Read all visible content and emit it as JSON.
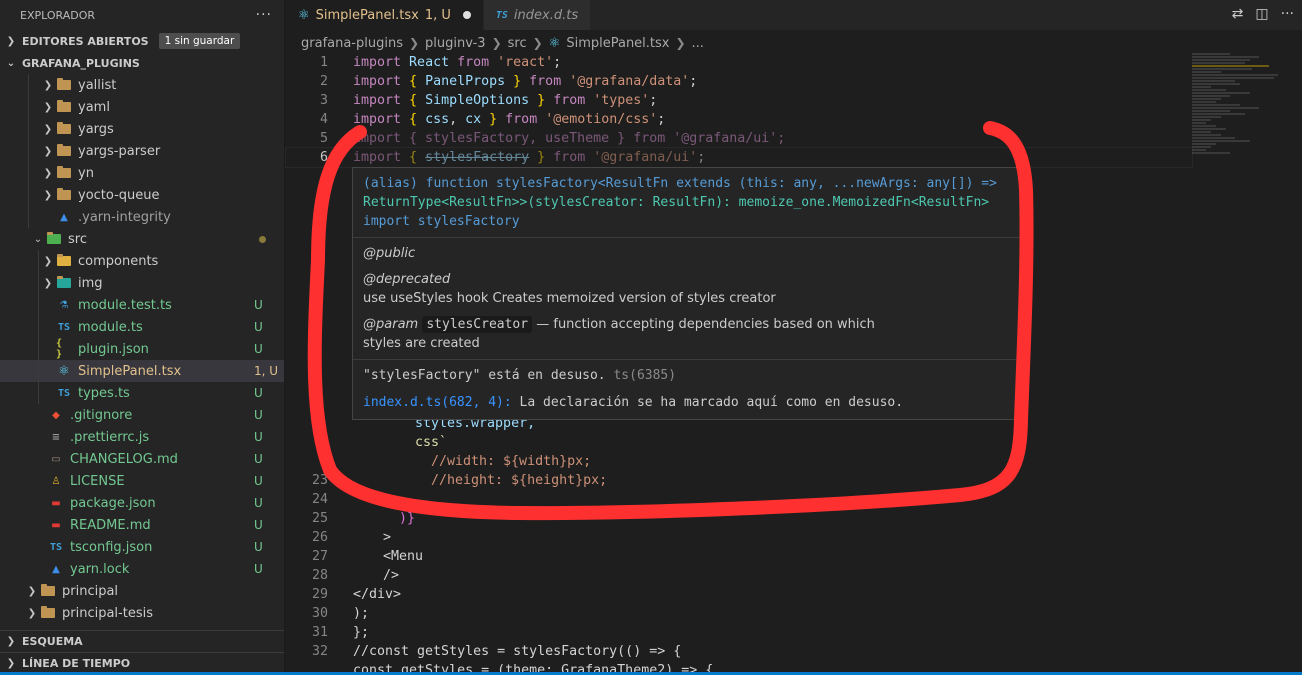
{
  "explorer": {
    "title": "EXPLORADOR",
    "more": "···",
    "open_editors": "EDITORES ABIERTOS",
    "unsaved_badge": "1 sin guardar",
    "workspace": "GRAFANA_PLUGINS",
    "items": [
      {
        "label": "yallist",
        "status": ""
      },
      {
        "label": "yaml",
        "status": ""
      },
      {
        "label": "yargs",
        "status": ""
      },
      {
        "label": "yargs-parser",
        "status": ""
      },
      {
        "label": "yn",
        "status": ""
      },
      {
        "label": "yocto-queue",
        "status": ""
      },
      {
        "label": ".yarn-integrity",
        "status": ""
      },
      {
        "label": "src",
        "status": ""
      },
      {
        "label": "components",
        "status": ""
      },
      {
        "label": "img",
        "status": ""
      },
      {
        "label": "module.test.ts",
        "status": "U"
      },
      {
        "label": "module.ts",
        "status": "U"
      },
      {
        "label": "plugin.json",
        "status": "U"
      },
      {
        "label": "SimplePanel.tsx",
        "status": "1, U"
      },
      {
        "label": "types.ts",
        "status": "U"
      },
      {
        "label": ".gitignore",
        "status": "U"
      },
      {
        "label": ".prettierrc.js",
        "status": "U"
      },
      {
        "label": "CHANGELOG.md",
        "status": "U"
      },
      {
        "label": "LICENSE",
        "status": "U"
      },
      {
        "label": "package.json",
        "status": "U"
      },
      {
        "label": "README.md",
        "status": "U"
      },
      {
        "label": "tsconfig.json",
        "status": "U"
      },
      {
        "label": "yarn.lock",
        "status": "U"
      },
      {
        "label": "principal",
        "status": ""
      },
      {
        "label": "principal-tesis",
        "status": ""
      }
    ],
    "outline": "ESQUEMA",
    "timeline": "LÍNEA DE TIEMPO"
  },
  "tabs": [
    {
      "label": "SimplePanel.tsx",
      "status": "1, U",
      "icon": "react-icon"
    },
    {
      "label": "index.d.ts",
      "icon": "ts-icon",
      "icon_text": "TS"
    }
  ],
  "breadcrumb": [
    "grafana-plugins",
    "pluginv-3",
    "src",
    "SimplePanel.tsx",
    "..."
  ],
  "code": {
    "line_numbers": [
      "1",
      "2",
      "3",
      "4",
      "5",
      "6",
      "",
      "",
      "",
      "",
      "",
      "",
      "",
      "",
      "",
      "",
      "",
      "",
      "",
      "",
      "",
      "",
      "23",
      "24",
      "25",
      "26",
      "27",
      "28",
      "29",
      "30",
      "31",
      "32",
      ""
    ],
    "l1": {
      "a": "import",
      "b": " React ",
      "c": "from",
      "d": " 'react'",
      "e": ";"
    },
    "l2": {
      "a": "import",
      "b": " { ",
      "c": "PanelProps",
      "d": " } ",
      "e": "from",
      "f": " '@grafana/data'",
      "g": ";"
    },
    "l3": {
      "a": "import",
      "b": " { ",
      "c": "SimpleOptions",
      "d": " } ",
      "e": "from",
      "f": " 'types'",
      "g": ";"
    },
    "l4": {
      "a": "import",
      "b": " { ",
      "c": "css",
      "d": ", ",
      "e": "cx",
      "f": " } ",
      "g": "from",
      "h": " '@emotion/css'",
      "i": ";"
    },
    "l5": "import { stylesFactory, useTheme } from '@grafana/ui';",
    "l6": {
      "a": "import",
      "b": " { ",
      "c": "stylesFactory",
      "d": " } ",
      "e": "from",
      "f": " '@grafana/ui'",
      "g": ";"
    },
    "l22": "styles.wrapper,",
    "l23": "css`",
    "l24a": "//width: ${width}px;",
    "l24b": "//height: ${height}px;",
    "l25": ")}",
    "l26": ">",
    "l27": "<Menu",
    "l28": "/>",
    "l29": "</div>",
    "l30": ");",
    "l31": "};",
    "l32": "//const getStyles = stylesFactory(() => {",
    "l33": "const getStyles = (theme: GrafanaTheme2) => {"
  },
  "hover": {
    "sig1": "(alias) function stylesFactory<ResultFn extends (this: any, ...newArgs: any[]) =>",
    "sig2": "ReturnType<ResultFn>>(stylesCreator: ResultFn): memoize_one.MemoizedFn<ResultFn>",
    "sig3": "import stylesFactory",
    "public": "@public",
    "deprecated": "@deprecated",
    "deprecated_text": "use useStyles hook Creates memoized version of styles creator",
    "param_tag": "@param",
    "param_name": "stylesCreator",
    "param_desc": "— function accepting dependencies based on which",
    "param_desc2": "styles are created",
    "diag_msg": "\"stylesFactory\" está en desuso.",
    "diag_code": "ts(6385)",
    "link": "index.d.ts(682, 4):",
    "link_msg": "La declaración se ha marcado aquí como en desuso."
  },
  "colors": {
    "accent": "#007acc",
    "scribble": "#ff3030",
    "untracked": "#73c991"
  }
}
